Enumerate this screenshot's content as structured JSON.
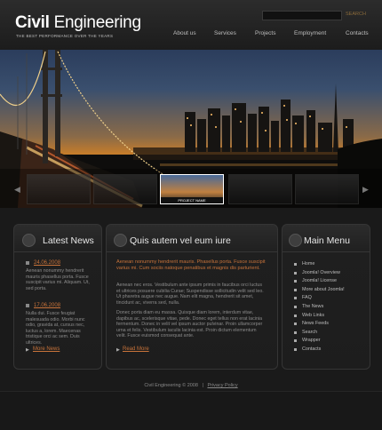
{
  "header": {
    "logo_bold": "Civil",
    "logo_rest": " Engineering",
    "tagline": "THE BEST PERFORMANCE OVER THE YEARS",
    "search_placeholder": "",
    "search_label": "SEARCH",
    "nav": [
      "About us",
      "Services",
      "Projects",
      "Employment",
      "Contacts"
    ]
  },
  "slider": {
    "active_caption": "PROJECT NAME",
    "prev_icon": "chevron-left-icon",
    "next_icon": "chevron-right-icon"
  },
  "latest_news": {
    "title": "Latest News",
    "items": [
      {
        "date": "24.06.2008",
        "text": "Aenean nonummy hendrerit mauris phasellus porta. Fusce suscipit varius mi. Aliquam. Ut, sed porta."
      },
      {
        "date": "17.06.2008",
        "text": "Nulla dui. Fusce feugiat malesuada odio. Morbi nunc odio, gravida at, cursus nec, luctus a, lorem. Maecenas tristique orci ac sem. Duis ultrices."
      }
    ],
    "more": "More News"
  },
  "main_content": {
    "title": "Quis autem vel eum iure",
    "lead": "Aenean nonummy hendrerit mauris. Phasellus porta. Fusce suscipit varius mi. Cum sociis natoque penatibus et magnis dis parturient.",
    "para1": "Aenean nec eros. Vestibulum ante ipsum primis in faucibus orci luctus et ultrices posuere cubilia Curae; Suspendisse sollicitudin velit sed leo. Ut pharetra augue nec augue. Nam elit magna, hendrerit sit amet, tincidunt ac, viverra sed, nulla.",
    "para2": "Donec porta diam eu massa. Quisque diam lorem, interdum vitae, dapibus ac, scelerisque vitae, pede. Donec eget tellus non erat lacinia fermentum. Donec in velit vel ipsum auctor pulvinar. Proin ullamcorper urna et felis. Vestibulum iaculis lacinia est. Proin dictum elementum velit. Fusce euismod consequat ante.",
    "more": "Read More"
  },
  "main_menu": {
    "title": "Main Menu",
    "items": [
      "Home",
      "Joomla! Overview",
      "Joomla! License",
      "More about Joomla!",
      "FAQ",
      "The News",
      "Web Links",
      "News Feeds",
      "Search",
      "Wrapper",
      "Contacts"
    ]
  },
  "footer": {
    "copyright": "Civil Engineering © 2008",
    "separator": "|",
    "privacy": "Privacy Policy"
  }
}
